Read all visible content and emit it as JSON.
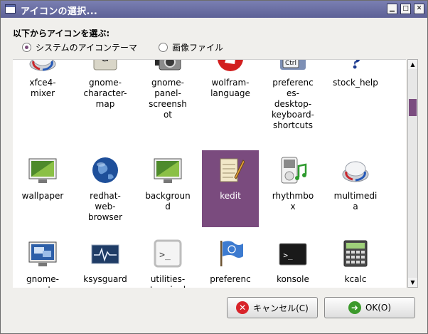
{
  "window": {
    "title": "アイコンの選択..."
  },
  "window_buttons": {
    "minimize": "▁",
    "maximize": "□",
    "close": "✕"
  },
  "heading": "以下からアイコンを選ぶ:",
  "source_options": [
    {
      "label": "システムのアイコンテーマ",
      "selected": true
    },
    {
      "label": "画像ファイル",
      "selected": false
    }
  ],
  "icons": [
    {
      "label": "xfce4-\nmixer",
      "icon": "mixer-knob-icon"
    },
    {
      "label": "gnome-\ncharacter-\nmap",
      "icon": "character-map-icon"
    },
    {
      "label": "gnome-\npanel-\nscreensh\not",
      "icon": "camera-icon"
    },
    {
      "label": "wolfram-\nlanguage",
      "icon": "wolfram-wolf-icon"
    },
    {
      "label": "preferenc\nes-\ndesktop-\nkeyboard-\nshortcuts",
      "icon": "keyboard-ctrl-icon"
    },
    {
      "label": "stock_help",
      "icon": "help-question-icon"
    },
    {
      "label": "wallpaper",
      "icon": "wallpaper-monitor-icon"
    },
    {
      "label": "redhat-\nweb-\nbrowser",
      "icon": "globe-icon"
    },
    {
      "label": "backgroun\nd",
      "icon": "background-monitor-icon"
    },
    {
      "label": "kedit",
      "icon": "notepad-pencil-icon",
      "selected": true
    },
    {
      "label": "rhythmbo\nx",
      "icon": "music-player-icon"
    },
    {
      "label": "multimedi\na",
      "icon": "multimedia-knob-icon"
    },
    {
      "label": "gnome-\nremote-",
      "icon": "remote-desktop-icon"
    },
    {
      "label": "ksysguard",
      "icon": "system-monitor-icon"
    },
    {
      "label": "utilities-\nterminal",
      "icon": "terminal-outline-icon"
    },
    {
      "label": "preferenc\nes-",
      "icon": "flag-icon"
    },
    {
      "label": "konsole",
      "icon": "konsole-terminal-icon"
    },
    {
      "label": "kcalc",
      "icon": "calculator-icon"
    }
  ],
  "colors": {
    "title_bar": "#6a6fa5",
    "selection": "#7a4b7e",
    "cancel_red": "#d8232a",
    "ok_green": "#3c9a2c"
  },
  "buttons": {
    "cancel": {
      "label": "キャンセル(C)",
      "icon": "cancel-icon"
    },
    "ok": {
      "label": "OK(O)",
      "icon": "ok-arrow-icon"
    }
  }
}
